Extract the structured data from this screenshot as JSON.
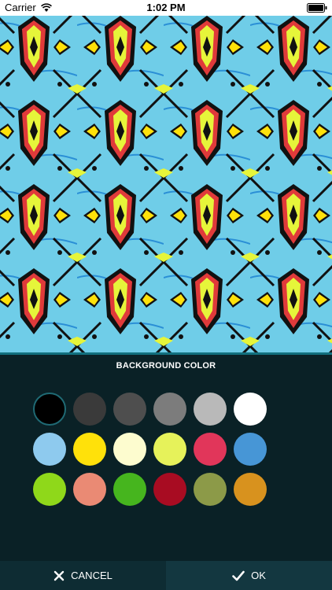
{
  "status_bar": {
    "carrier": "Carrier",
    "time": "1:02 PM"
  },
  "pattern": {
    "description_colors": {
      "background": "#6fcde8",
      "outline": "#111111",
      "primary": "#e6f53a",
      "secondary": "#e03a3a",
      "accent": "#2a8fd6"
    }
  },
  "panel": {
    "title": "BACKGROUND COLOR",
    "swatches": [
      "#000000",
      "#3a3a3a",
      "#4e4e4e",
      "#7c7c7c",
      "#b9b9b9",
      "#ffffff",
      "#8ecaee",
      "#ffe10a",
      "#fdfccf",
      "#e6f25a",
      "#e1365a",
      "#4796d6",
      "#8fd81a",
      "#ea8a74",
      "#46b51e",
      "#a80c22",
      "#8c9a48",
      "#d8921e"
    ],
    "selected_index": 0
  },
  "footer": {
    "cancel_label": "CANCEL",
    "ok_label": "OK"
  }
}
